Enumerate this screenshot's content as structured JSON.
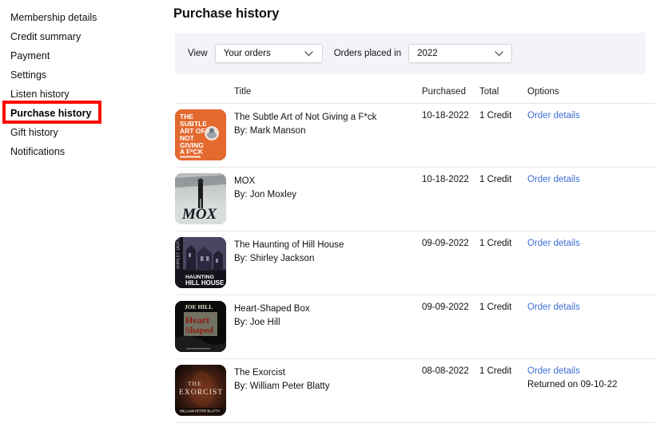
{
  "sidebar": {
    "items": [
      {
        "label": "Membership details",
        "selected": false
      },
      {
        "label": "Credit summary",
        "selected": false
      },
      {
        "label": "Payment",
        "selected": false
      },
      {
        "label": "Settings",
        "selected": false
      },
      {
        "label": "Listen history",
        "selected": false
      },
      {
        "label": "Purchase history",
        "selected": true
      },
      {
        "label": "Gift history",
        "selected": false
      },
      {
        "label": "Notifications",
        "selected": false
      }
    ],
    "highlight_color": "#fb0b00"
  },
  "main": {
    "page_title": "Purchase history",
    "filters": {
      "view_label": "View",
      "view_value": "Your orders",
      "year_label": "Orders placed in",
      "year_value": "2022"
    },
    "table": {
      "headers": {
        "title": "Title",
        "purchased": "Purchased",
        "total": "Total",
        "options": "Options"
      },
      "rows": [
        {
          "title": "The Subtle Art of Not Giving a F*ck",
          "author": "By: Mark Manson",
          "purchased": "10-18-2022",
          "total": "1 Credit",
          "order_details": "Order details",
          "returned": "",
          "cover": "subtle-art"
        },
        {
          "title": "MOX",
          "author": "By: Jon Moxley",
          "purchased": "10-18-2022",
          "total": "1 Credit",
          "order_details": "Order details",
          "returned": "",
          "cover": "mox"
        },
        {
          "title": "The Haunting of Hill House",
          "author": "By: Shirley Jackson",
          "purchased": "09-09-2022",
          "total": "1 Credit",
          "order_details": "Order details",
          "returned": "",
          "cover": "hill-house"
        },
        {
          "title": "Heart-Shaped Box",
          "author": "By: Joe Hill",
          "purchased": "09-09-2022",
          "total": "1 Credit",
          "order_details": "Order details",
          "returned": "",
          "cover": "heart-shaped-box"
        },
        {
          "title": "The Exorcist",
          "author": "By: William Peter Blatty",
          "purchased": "08-08-2022",
          "total": "1 Credit",
          "order_details": "Order details",
          "returned": "Returned on 09-10-22",
          "cover": "exorcist"
        }
      ]
    }
  },
  "colors": {
    "link": "#3c6ed5",
    "filter_bar_bg": "#f2f4fa",
    "highlight": "#fb0b00"
  }
}
